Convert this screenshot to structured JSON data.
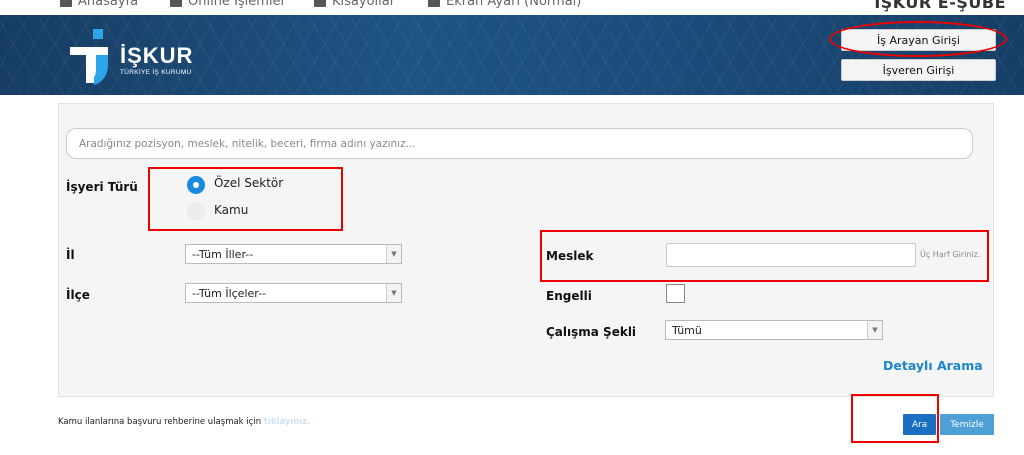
{
  "topbar": {
    "items": [
      "Anasayfa",
      "Online İşlemler",
      "Kısayollar",
      "Ekran Ayarı (Normal)"
    ],
    "brand": "İŞKUR E-ŞUBE"
  },
  "header": {
    "logo_text": "İŞKUR",
    "logo_sub": "TÜRKİYE İŞ KURUMU",
    "job_seeker_login": "İş Arayan Girişi",
    "employer_login": "İşveren Girişi"
  },
  "search": {
    "placeholder": "Aradığınız pozisyon, meslek, nitelik, beceri, firma adını yazınız...",
    "value": ""
  },
  "filters": {
    "workplace_type_label": "İşyeri Türü",
    "workplace_options": [
      {
        "label": "Özel Sektör",
        "selected": true
      },
      {
        "label": "Kamu",
        "selected": false
      }
    ],
    "province_label": "İl",
    "province_value": "--Tüm İller--",
    "district_label": "İlçe",
    "district_value": "--Tüm İlçeler--",
    "profession_label": "Meslek",
    "profession_value": "",
    "profession_hint": "Üç Harf Giriniz.",
    "disabled_label": "Engelli",
    "disabled_checked": false,
    "work_type_label": "Çalışma Şekli",
    "work_type_value": "Tümü",
    "detailed_search": "Detaylı Arama"
  },
  "footer": {
    "text": "Kamu ilanlarına başvuru rehberine ulaşmak için",
    "link": "tıklayınız.",
    "search_button": "Ara",
    "clear_button": "Temizle"
  },
  "colors": {
    "header_blue": "#1e5384",
    "accent_blue": "#1a8ae0",
    "link_blue": "#1b86c9",
    "highlight_red": "#e00000"
  }
}
